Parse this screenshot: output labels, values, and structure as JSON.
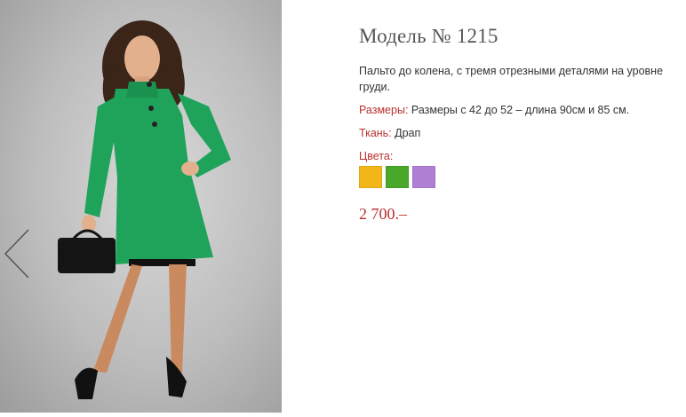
{
  "product": {
    "title": "Модель № 1215",
    "description": "Пальто до колена, с тремя отрезными деталями на уровне груди.",
    "sizes_label": "Размеры:",
    "sizes_value": "Размеры с 42 до 52 – длина 90см и 85 см.",
    "fabric_label": "Ткань:",
    "fabric_value": "Драп",
    "colors_label": "Цвета:",
    "colors": [
      {
        "name": "yellow",
        "hex": "#f2b619"
      },
      {
        "name": "green",
        "hex": "#49a82a"
      },
      {
        "name": "purple",
        "hex": "#b07fd6"
      }
    ],
    "price": "2 700.–"
  },
  "gallery": {
    "prev_icon": "chevron-left-icon",
    "coat_color": "#1fa35a"
  }
}
